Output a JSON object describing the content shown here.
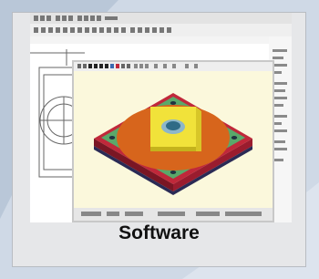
{
  "caption": "Software",
  "icons": {
    "main_window": "cad-main-window",
    "popup_window": "3d-view-window",
    "model": "isometric-plate-model"
  },
  "colors": {
    "card_bg": "#e6e7e9",
    "page_bg": "#cfd9e6",
    "window_bg": "#fbf8dc",
    "plate_red": "#c0283a",
    "plate_green": "#5aa86a",
    "plate_orange": "#d7651c",
    "plate_yellow": "#f1e23a"
  }
}
